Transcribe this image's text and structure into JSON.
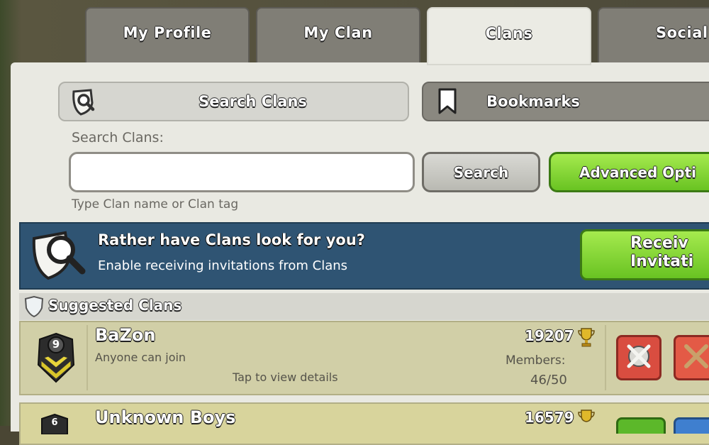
{
  "tabs": [
    {
      "label": "My Profile",
      "active": false
    },
    {
      "label": "My Clan",
      "active": false
    },
    {
      "label": "Clans",
      "active": true
    },
    {
      "label": "Social",
      "active": false
    }
  ],
  "subtabs": {
    "search_clans": "Search Clans",
    "bookmarks": "Bookmarks"
  },
  "search": {
    "label": "Search Clans:",
    "value": "",
    "hint": "Type Clan name or Clan tag",
    "button": "Search",
    "advanced_button": "Advanced Opti"
  },
  "banner": {
    "title": "Rather have Clans look for you?",
    "subtitle": "Enable receiving invitations from Clans",
    "button": "Receiv\nInvitati"
  },
  "suggested": {
    "title": "Suggested Clans",
    "clans": [
      {
        "name": "BaZon",
        "level": "9",
        "type": "Anyone can join",
        "trophies": "19207",
        "members_label": "Members:",
        "members": "46/50",
        "tap": "Tap to view details"
      },
      {
        "name": "Unknown Boys",
        "level": "6",
        "trophies": "16579"
      }
    ]
  },
  "colors": {
    "banner_bg": "#2f5473",
    "green_button": "#69c322",
    "war_button": "#d94d40"
  }
}
